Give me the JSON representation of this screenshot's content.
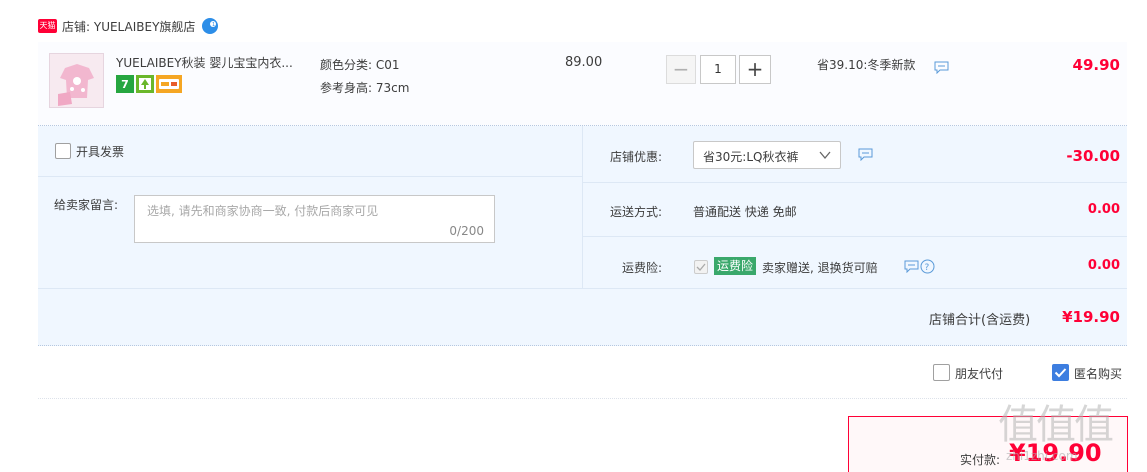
{
  "shop": {
    "badge": "天猫",
    "label": "店铺: YUELAIBEY旗舰店"
  },
  "item": {
    "title": "YUELAIBEY秋装 婴儿宝宝内衣...",
    "promo_icons": [
      "7",
      "tree-icon",
      "card-icon"
    ],
    "sku_color": "颜色分类: C01",
    "sku_height": "参考身高: 73cm",
    "unit_price": "89.00",
    "qty_minus": "−",
    "quantity": "1",
    "qty_plus": "+",
    "promo": "省39.10:冬季新款",
    "subtotal": "49.90"
  },
  "invoice": {
    "label": "开具发票"
  },
  "message": {
    "label": "给卖家留言:",
    "placeholder": "选填, 请先和商家协商一致, 付款后商家可见",
    "counter": "0/200"
  },
  "coupon": {
    "label": "店铺优惠:",
    "selected": "省30元:LQ秋衣裤",
    "amount": "-30.00"
  },
  "shipping": {
    "label": "运送方式:",
    "value": "普通配送 快递 免邮",
    "amount": "0.00"
  },
  "insurance": {
    "label": "运费险:",
    "badge": "运费险",
    "desc": "卖家赠送, 退换货可赔",
    "amount": "0.00"
  },
  "store_total": {
    "label": "店铺合计(含运费)",
    "amount": "¥19.90"
  },
  "options": {
    "friend_pay": "朋友代付",
    "anonymous": "匿名购买",
    "anonymous_checked": true
  },
  "payment": {
    "label": "实付款:",
    "amount": "¥19.90"
  },
  "watermark": {
    "logo": "值值值",
    "url": "zhi1zhi.com"
  },
  "colors": {
    "accent": "#ff0036",
    "panel": "#f0f7ff",
    "checkbox_blue": "#3d7ee0",
    "insurance_green": "#3aa86b"
  }
}
